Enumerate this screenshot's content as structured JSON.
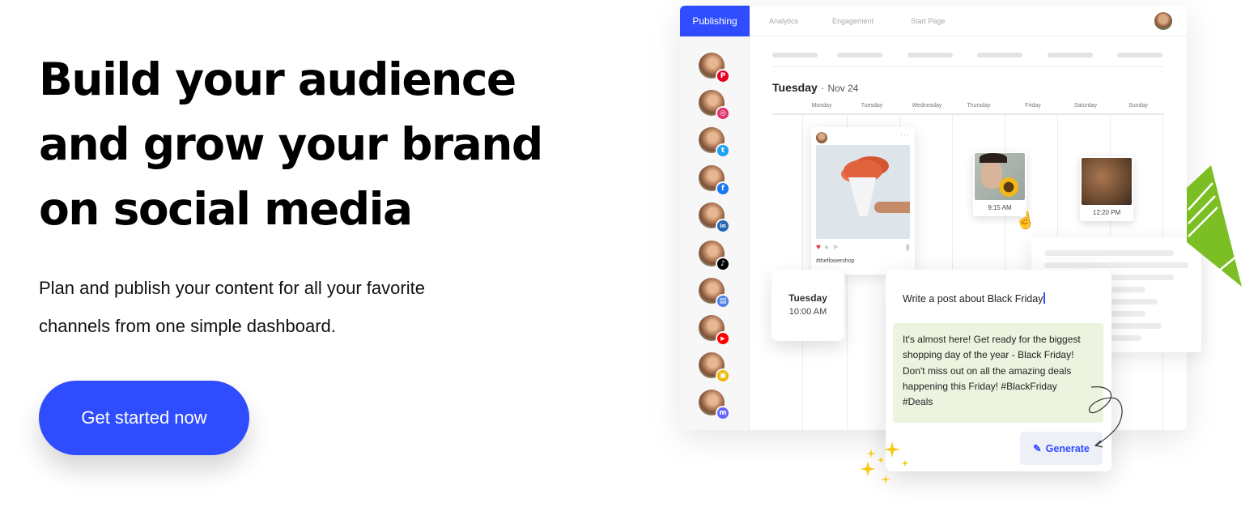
{
  "hero": {
    "title_lines": [
      "Build your audience",
      "and grow your brand",
      "on social media"
    ],
    "subtitle_lines": [
      "Plan and publish your content for all your favorite",
      "channels from one simple dashboard."
    ],
    "cta_label": "Get started now",
    "accent_color": "#2f4dff"
  },
  "dashboard": {
    "tabs": [
      {
        "label": "Publishing",
        "active": true
      },
      {
        "label": "Analytics",
        "active": false
      },
      {
        "label": "Engagement",
        "active": false
      },
      {
        "label": "Start Page",
        "active": false
      }
    ],
    "channels": [
      {
        "name": "pinterest",
        "icon": "P",
        "color": "#e60023"
      },
      {
        "name": "instagram",
        "icon": "◎",
        "color": "#e1306c"
      },
      {
        "name": "twitter",
        "icon": "t",
        "color": "#1da1f2"
      },
      {
        "name": "facebook",
        "icon": "f",
        "color": "#1877f2"
      },
      {
        "name": "linkedin",
        "icon": "in",
        "color": "#2867b2"
      },
      {
        "name": "tiktok",
        "icon": "♪",
        "color": "#000000"
      },
      {
        "name": "google-business",
        "icon": "▤",
        "color": "#4f7fe8"
      },
      {
        "name": "youtube",
        "icon": "▶",
        "color": "#ff0000"
      },
      {
        "name": "start-page",
        "icon": "▣",
        "color": "#f0b400"
      },
      {
        "name": "mastodon",
        "icon": "m",
        "color": "#6364ff"
      }
    ],
    "calendar": {
      "day_label": "Tuesday",
      "date_label": "Nov 24",
      "weekdays": [
        "Monday",
        "Tuesday",
        "Wednesday",
        "Thursday",
        "Friday",
        "Saturday",
        "Sunday"
      ]
    },
    "post_card": {
      "hashtag": "#theflowershop",
      "more_icon": "···"
    },
    "scheduled": [
      {
        "time": "9:15 AM"
      },
      {
        "time": "12:20 PM"
      }
    ],
    "time_card": {
      "day": "Tuesday",
      "time": "10:00 AM"
    }
  },
  "ai_assistant": {
    "prompt": "Write a post about Black Friday",
    "result_lines": [
      "It's almost here! Get ready for the biggest",
      "shopping day of the year - Black Friday!",
      "Don't miss out on all the amazing deals",
      "happening this Friday! #BlackFriday",
      "#Deals"
    ],
    "generate_label": "Generate",
    "result_bg": "#ecf4df"
  }
}
